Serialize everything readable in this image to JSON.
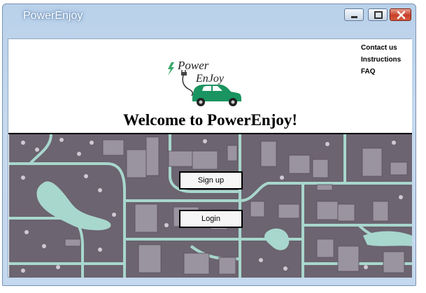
{
  "window": {
    "title": "PowerEnjoy"
  },
  "nav": {
    "links": [
      "Contact us",
      "Instructions",
      "FAQ"
    ]
  },
  "logo": {
    "text_line1": "Power",
    "text_line2": "EnJoy",
    "car_color": "#1a9460"
  },
  "main": {
    "welcome": "Welcome to PowerEnjoy!",
    "signup_label": "Sign up",
    "login_label": "Login"
  },
  "colors": {
    "map_background": "#6c6470",
    "map_roads": "#a8d7cd",
    "map_buildings": "#9a93a0"
  }
}
